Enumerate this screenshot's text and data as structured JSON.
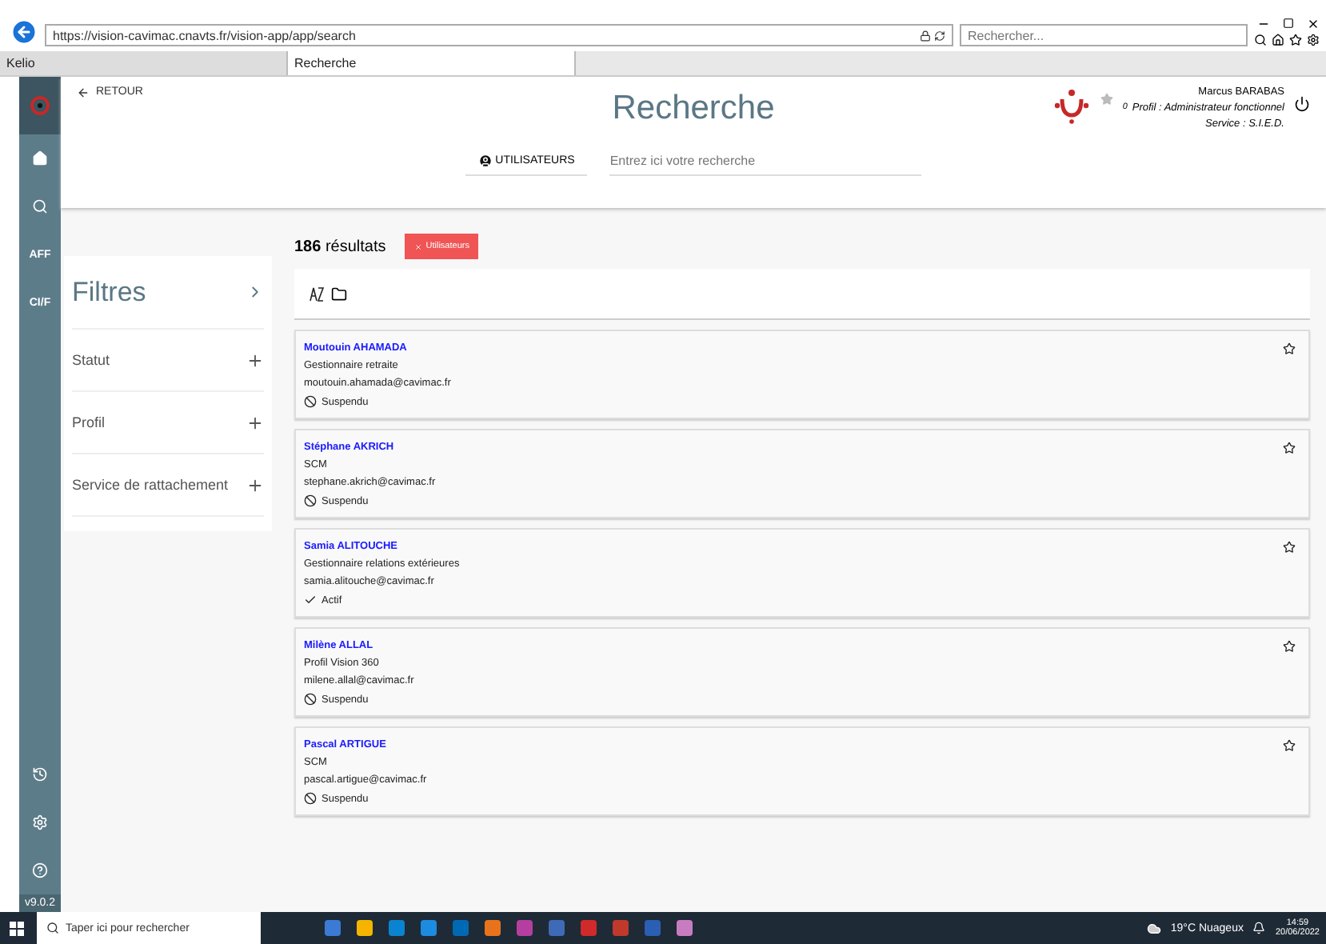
{
  "browser": {
    "url": "https://vision-cavimac.cnavts.fr/vision-app/app/search",
    "search_placeholder": "Rechercher...",
    "tabs": [
      {
        "label": "Kelio",
        "selected": false
      },
      {
        "label": "Recherche",
        "selected": true
      }
    ]
  },
  "sidebar": {
    "items": [
      {
        "kind": "home"
      },
      {
        "kind": "search"
      },
      {
        "kind": "text",
        "label": "AFF"
      },
      {
        "kind": "text",
        "label": "CI/F"
      }
    ],
    "bottom_items": [
      {
        "kind": "history"
      },
      {
        "kind": "settings"
      },
      {
        "kind": "help"
      }
    ],
    "version": "v9.0.2"
  },
  "header": {
    "back": "RETOUR",
    "title": "Recherche",
    "scope": "UTILISATEURS",
    "search_placeholder": "Entrez ici votre recherche",
    "user": {
      "name": "Marcus BARABAS",
      "favorites": "0",
      "profile": "Profil : Administrateur fonctionnel",
      "service": "Service : S.I.E.D."
    }
  },
  "filters": {
    "title": "Filtres",
    "items": [
      {
        "label": "Statut"
      },
      {
        "label": "Profil"
      },
      {
        "label": "Service de rattachement"
      }
    ]
  },
  "results": {
    "count": "186",
    "count_label": "résultats",
    "tag": "Utilisateurs",
    "items": [
      {
        "name": "Moutouin AHAMADA",
        "profile": "Gestionnaire retraite",
        "email": "moutouin.ahamada@cavimac.fr",
        "status": "Suspendu",
        "kind": "suspended",
        "favorite": false
      },
      {
        "name": "Stéphane AKRICH",
        "profile": "SCM",
        "email": "stephane.akrich@cavimac.fr",
        "status": "Suspendu",
        "kind": "suspended",
        "favorite": false
      },
      {
        "name": "Samia ALITOUCHE",
        "profile": "Gestionnaire relations extérieures",
        "email": "samia.alitouche@cavimac.fr",
        "status": "Actif",
        "kind": "active",
        "favorite": false
      },
      {
        "name": "Milène ALLAL",
        "profile": "Profil Vision 360",
        "email": "milene.allal@cavimac.fr",
        "status": "Suspendu",
        "kind": "suspended",
        "favorite": false
      },
      {
        "name": "Pascal ARTIGUE",
        "profile": "SCM",
        "email": "pascal.artigue@cavimac.fr",
        "status": "Suspendu",
        "kind": "suspended",
        "favorite": false
      }
    ]
  },
  "taskbar": {
    "search_placeholder": "Taper ici pour rechercher",
    "weather": "19°C Nuageux",
    "time": "14:59",
    "date": "20/06/2022"
  }
}
